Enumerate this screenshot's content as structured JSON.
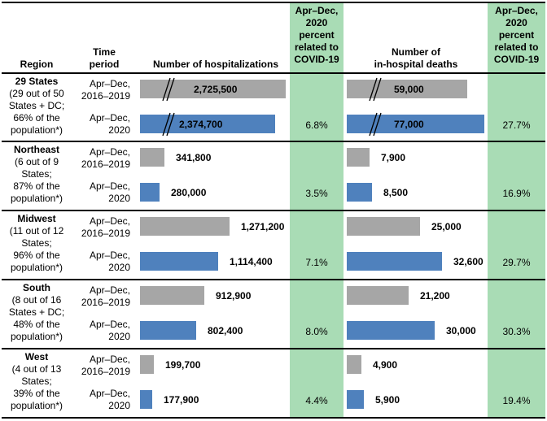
{
  "headers": {
    "region": "Region",
    "time_period": [
      "Time",
      "period"
    ],
    "hospitalizations": "Number of hospitalizations",
    "hosp_pct": [
      "Apr–Dec,",
      "2020",
      "percent",
      "related to",
      "COVID-19"
    ],
    "deaths": [
      "Number of",
      "in-hospital deaths"
    ],
    "deaths_pct": [
      "Apr–Dec,",
      "2020",
      "percent",
      "related to",
      "COVID-19"
    ]
  },
  "colors": {
    "baseline_bar": "#a6a6a6",
    "covid_bar": "#4f81bd",
    "pct_column": "#a9dcb5"
  },
  "periods": {
    "baseline": [
      "Apr–Dec,",
      "2016–2019"
    ],
    "covid": [
      "Apr–Dec,",
      "2020"
    ]
  },
  "chart_data": {
    "type": "bar",
    "orientation": "horizontal",
    "title": "",
    "series": [
      {
        "name": "Apr–Dec, 2016–2019"
      },
      {
        "name": "Apr–Dec, 2020"
      }
    ],
    "regions": [
      {
        "name": "29 States",
        "desc": [
          "(29 out of 50",
          "States + DC;",
          "66% of the",
          "population*)"
        ],
        "hosp_baseline": 2725500,
        "hosp_covid": 2374700,
        "hosp_covid_pct": "6.8%",
        "deaths_baseline": 59000,
        "deaths_covid": 77000,
        "deaths_covid_pct": "27.7%",
        "axis_break": true,
        "labels": {
          "hb": "2,725,500",
          "hc": "2,374,700",
          "db": "59,000",
          "dc": "77,000"
        }
      },
      {
        "name": "Northeast",
        "desc": [
          "(6 out of 9",
          "States;",
          "87% of the",
          "population*)"
        ],
        "hosp_baseline": 341800,
        "hosp_covid": 280000,
        "hosp_covid_pct": "3.5%",
        "deaths_baseline": 7900,
        "deaths_covid": 8500,
        "deaths_covid_pct": "16.9%",
        "axis_break": false,
        "labels": {
          "hb": "341,800",
          "hc": "280,000",
          "db": "7,900",
          "dc": "8,500"
        }
      },
      {
        "name": "Midwest",
        "desc": [
          "(11 out of 12",
          "States;",
          "96% of the",
          "population*)"
        ],
        "hosp_baseline": 1271200,
        "hosp_covid": 1114400,
        "hosp_covid_pct": "7.1%",
        "deaths_baseline": 25000,
        "deaths_covid": 32600,
        "deaths_covid_pct": "29.7%",
        "axis_break": false,
        "labels": {
          "hb": "1,271,200",
          "hc": "1,114,400",
          "db": "25,000",
          "dc": "32,600"
        }
      },
      {
        "name": "South",
        "desc": [
          "(8 out of 16",
          "States + DC;",
          "48% of the",
          "population*)"
        ],
        "hosp_baseline": 912900,
        "hosp_covid": 802400,
        "hosp_covid_pct": "8.0%",
        "deaths_baseline": 21200,
        "deaths_covid": 30000,
        "deaths_covid_pct": "30.3%",
        "axis_break": false,
        "labels": {
          "hb": "912,900",
          "hc": "802,400",
          "db": "21,200",
          "dc": "30,000"
        }
      },
      {
        "name": "West",
        "desc": [
          "(4 out of 13",
          "States;",
          "39% of the",
          "population*)"
        ],
        "hosp_baseline": 199700,
        "hosp_covid": 177900,
        "hosp_covid_pct": "4.4%",
        "deaths_baseline": 4900,
        "deaths_covid": 5900,
        "deaths_covid_pct": "19.4%",
        "axis_break": false,
        "labels": {
          "hb": "199,700",
          "hc": "177,900",
          "db": "4,900",
          "dc": "5,900"
        }
      }
    ]
  }
}
